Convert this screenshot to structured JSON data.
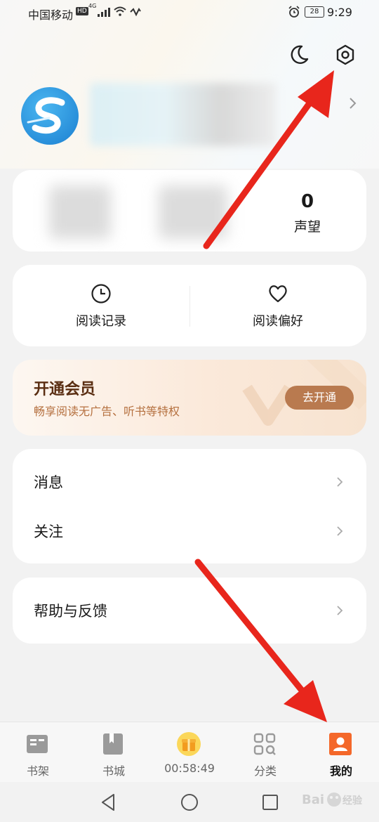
{
  "status_bar": {
    "carrier": "中国移动",
    "hd": "HD",
    "network": "4G",
    "battery": "28",
    "time": "9:29"
  },
  "header": {
    "night_mode_icon": "moon-icon",
    "settings_icon": "gear-icon"
  },
  "stats": {
    "reputation_value": "0",
    "reputation_label": "声望"
  },
  "quick_actions": [
    {
      "label": "阅读记录",
      "icon": "clock-icon"
    },
    {
      "label": "阅读偏好",
      "icon": "heart-icon"
    }
  ],
  "vip": {
    "title": "开通会员",
    "subtitle": "畅享阅读无广告、听书等特权",
    "button": "去开通"
  },
  "menu": {
    "messages": "消息",
    "follow": "关注",
    "help": "帮助与反馈"
  },
  "tabs": [
    {
      "label": "书架",
      "icon": "bookshelf-icon"
    },
    {
      "label": "书城",
      "icon": "bookstore-icon"
    },
    {
      "label": "00:58:49",
      "icon": "gift-icon"
    },
    {
      "label": "分类",
      "icon": "category-icon"
    },
    {
      "label": "我的",
      "icon": "profile-icon"
    }
  ],
  "active_tab": "我的",
  "colors": {
    "accent": "#f4682a",
    "vip_button": "#b97a4f",
    "arrow": "#e8261c"
  }
}
